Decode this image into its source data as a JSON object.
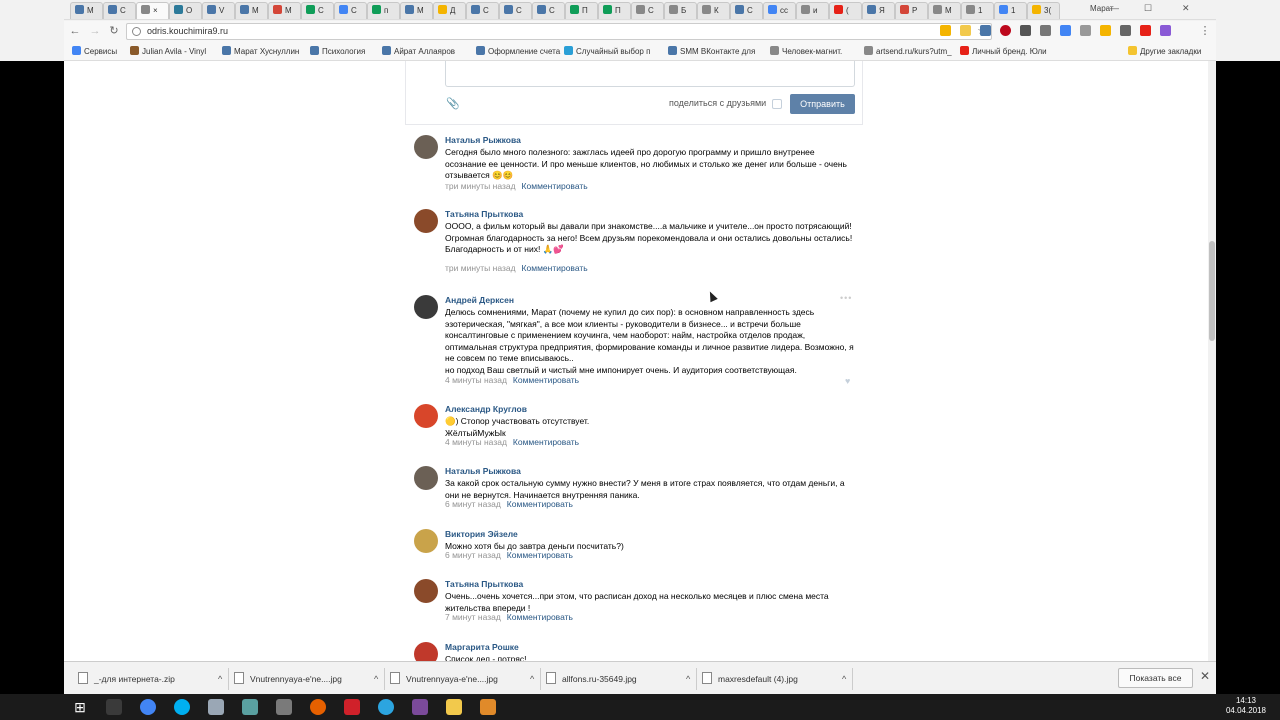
{
  "browser": {
    "profile_name": "Марат",
    "tabs": [
      {
        "label": "М",
        "color": "#4a76a8"
      },
      {
        "label": "С",
        "color": "#4a76a8"
      },
      {
        "label": "×",
        "color": "#888888"
      },
      {
        "label": "О",
        "color": "#2c7a9a"
      },
      {
        "label": "V",
        "color": "#4a76a8"
      },
      {
        "label": "М",
        "color": "#4a76a8"
      },
      {
        "label": "М",
        "color": "#d44638"
      },
      {
        "label": "С",
        "color": "#0f9d58"
      },
      {
        "label": "С",
        "color": "#4285f4"
      },
      {
        "label": "п",
        "color": "#0f9d58"
      },
      {
        "label": "М",
        "color": "#4a76a8"
      },
      {
        "label": "Д",
        "color": "#f4b400"
      },
      {
        "label": "С",
        "color": "#4a76a8"
      },
      {
        "label": "С",
        "color": "#4a76a8"
      },
      {
        "label": "С",
        "color": "#4a76a8"
      },
      {
        "label": "П",
        "color": "#0f9d58"
      },
      {
        "label": "П",
        "color": "#0f9d58"
      },
      {
        "label": "С",
        "color": "#888888"
      },
      {
        "label": "Б",
        "color": "#888888"
      },
      {
        "label": "К",
        "color": "#888888"
      },
      {
        "label": "С",
        "color": "#4a76a8"
      },
      {
        "label": "сс",
        "color": "#4285f4"
      },
      {
        "label": "и",
        "color": "#888888"
      },
      {
        "label": "(",
        "color": "#e62117"
      },
      {
        "label": "Я",
        "color": "#4a76a8"
      },
      {
        "label": "Р",
        "color": "#d44638"
      },
      {
        "label": "М",
        "color": "#888888"
      },
      {
        "label": "1",
        "color": "#888888"
      },
      {
        "label": "1",
        "color": "#4285f4"
      },
      {
        "label": "3(",
        "color": "#f4b400"
      }
    ],
    "url": "odris.kouchimira9.ru",
    "bookmarks": [
      {
        "label": "Сервисы",
        "color": "#4285f4"
      },
      {
        "label": "Julian Avila - Vinyl",
        "color": "#8a5a2b"
      },
      {
        "label": "Марат Хуснуллин",
        "color": "#4a76a8"
      },
      {
        "label": "Психология",
        "color": "#4a76a8"
      },
      {
        "label": "Айрат Аллаяров",
        "color": "#4a76a8"
      },
      {
        "label": "Оформление счета",
        "color": "#4a76a8"
      },
      {
        "label": "Случайный выбор п",
        "color": "#2a9fd6"
      },
      {
        "label": "SMM ВКонтакте для",
        "color": "#4a76a8"
      },
      {
        "label": "Человек-магнит.",
        "color": "#888888"
      },
      {
        "label": "artsend.ru/kurs?utm_",
        "color": "#888888"
      },
      {
        "label": "Личный бренд. Юли",
        "color": "#e62117"
      }
    ],
    "other_bookmarks": "Другие закладки"
  },
  "comment_form": {
    "share_label": "поделиться с друзьями",
    "send_label": "Отправить"
  },
  "comments": [
    {
      "author": "Наталья Рыжкова",
      "text": "Сегодня было много полезного: зажглась идеей про дорогую программу и пришло внутренее осознание ее ценности. И про меньше клиентов, но любимых и столько же денег или больше - очень отзывается 😊😊",
      "time": "три минуты назад",
      "reply": "Комментировать",
      "avatar_color": "#6b6055"
    },
    {
      "author": "Татьяна Прыткова",
      "text": "ОООО, а фильм который вы давали при знакомстве....а мальчике и учителе...он просто потрясающий!\nОгромная благодарность за него! Всем друзьям порекомендовала и они остались довольны остались! Благодарность и от них! 🙏💕",
      "time": "три минуты назад",
      "reply": "Комментировать",
      "avatar_color": "#8a4a2a"
    },
    {
      "author": "Андрей Дерксен",
      "text": "Делюсь сомнениями, Марат (почему не купил до сих пор): в основном направленность здесь эзотерическая, \"мягкая\", а все мои клиенты - руководители в бизнесе... и встречи больше консалтинговые с применением коучинга, чем наоборот: найм, настройка отделов продаж, оптимальная структура предприятия, формирование команды и личное развитие лидера. Возможно, я не совсем по теме вписываюсь..\nно подход Ваш светлый и чистый мне импонирует очень. И аудитория соответствующая.",
      "time": "4 минуты назад",
      "reply": "Комментировать",
      "avatar_color": "#3a3a3a"
    },
    {
      "author": "Александр Круглов",
      "text": "🟡) Стопор участвовать отсутствует.\nЖёлтыйМужЫк",
      "time": "4 минуты назад",
      "reply": "Комментировать",
      "avatar_color": "#d8462a"
    },
    {
      "author": "Наталья Рыжкова",
      "text": "За какой срок остальную сумму нужно внести? У меня в итоге страх появляется, что отдам деньги, а они не вернутся. Начинается внутренняя паника.",
      "time": "6 минут назад",
      "reply": "Комментировать",
      "avatar_color": "#6b6055"
    },
    {
      "author": "Виктория Эйзеле",
      "text": "Можно хотя бы до завтра деньги посчитать?)",
      "time": "6 минут назад",
      "reply": "Комментировать",
      "avatar_color": "#c9a34a"
    },
    {
      "author": "Татьяна Прыткова",
      "text": "Очень...очень хочется...при этом, что расписан доход на несколько месяцев и плюс смена места жительства впереди !",
      "time": "7 минут назад",
      "reply": "Комментировать",
      "avatar_color": "#8a4a2a"
    },
    {
      "author": "Маргарита Рошке",
      "text": "Список дел - потряс!",
      "time": "",
      "reply": "",
      "avatar_color": "#c0392b"
    }
  ],
  "downloads": {
    "items": [
      "_-для интернета-.zip",
      "Vnutrennyaya-e'ne....jpg",
      "Vnutrennyaya-e'ne....jpg",
      "allfons.ru-35649.jpg",
      "maxresdefault (4).jpg"
    ],
    "show_all": "Показать все"
  },
  "taskbar": {
    "time": "14:13",
    "date": "04.04.2018",
    "apps": [
      {
        "name": "task-view-icon",
        "color": "#3a3a3a"
      },
      {
        "name": "chrome-icon",
        "color": "#4285f4"
      },
      {
        "name": "skype-icon",
        "color": "#00aff0"
      },
      {
        "name": "notepad-icon",
        "color": "#9aa7b5"
      },
      {
        "name": "app-icon",
        "color": "#5aa0a0"
      },
      {
        "name": "app-icon",
        "color": "#7a7a7a"
      },
      {
        "name": "firefox-icon",
        "color": "#e66000"
      },
      {
        "name": "app-icon",
        "color": "#d0212a"
      },
      {
        "name": "telegram-icon",
        "color": "#2ca5e0"
      },
      {
        "name": "app-icon",
        "color": "#7b4a9a"
      },
      {
        "name": "explorer-icon",
        "color": "#f2c94c"
      },
      {
        "name": "app-icon",
        "color": "#e08a2a"
      }
    ]
  }
}
